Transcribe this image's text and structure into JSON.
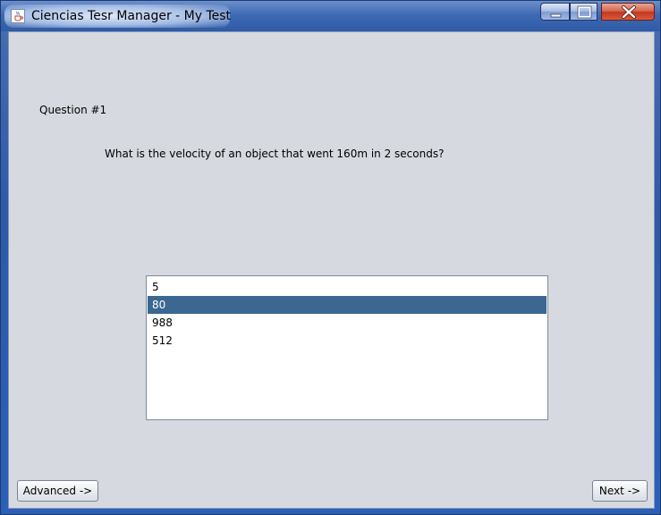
{
  "window": {
    "title": "Ciencias Tesr Manager - My Test",
    "icon": "java-cup-icon",
    "controls": {
      "minimize": "minimize-icon",
      "maximize": "maximize-icon",
      "close": "close-icon"
    }
  },
  "question": {
    "label": "Question #1",
    "text": "What is the velocity of an object that went 160m in 2 seconds?"
  },
  "answers": {
    "items": [
      "5",
      "80",
      "988",
      "512"
    ],
    "selected": "80"
  },
  "buttons": {
    "advanced": "Advanced ->",
    "next": "Next ->"
  },
  "colors": {
    "selection": "#3b6790",
    "client_background": "#d6d9df",
    "close_button": "#c4381f"
  }
}
